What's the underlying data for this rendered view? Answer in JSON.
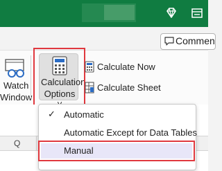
{
  "ribbon": {
    "comments_label": "Commen",
    "watch_window": {
      "line1": "Watch",
      "line2": "Window"
    },
    "calculation_options": {
      "line1": "Calculation",
      "line2": "Options",
      "arrow": "˅"
    },
    "calculate_now": "Calculate Now",
    "calculate_sheet": "Calculate Sheet"
  },
  "grid": {
    "column_label": "Q"
  },
  "menu": {
    "items": [
      {
        "label": "Automatic",
        "checked": true,
        "check": "✓"
      },
      {
        "label": "Automatic Except for Data Tables",
        "checked": false
      },
      {
        "label": "Manual",
        "checked": false
      }
    ]
  },
  "colors": {
    "excel_green": "#107c41",
    "highlight_red": "#e0383e",
    "hover": "#e8e6f8"
  },
  "icons": [
    "diamond-icon",
    "ribbon-display-icon",
    "comment-icon",
    "watch-window-icon",
    "calculator-icon",
    "calculate-now-icon",
    "calculate-sheet-icon",
    "checkmark-icon"
  ]
}
